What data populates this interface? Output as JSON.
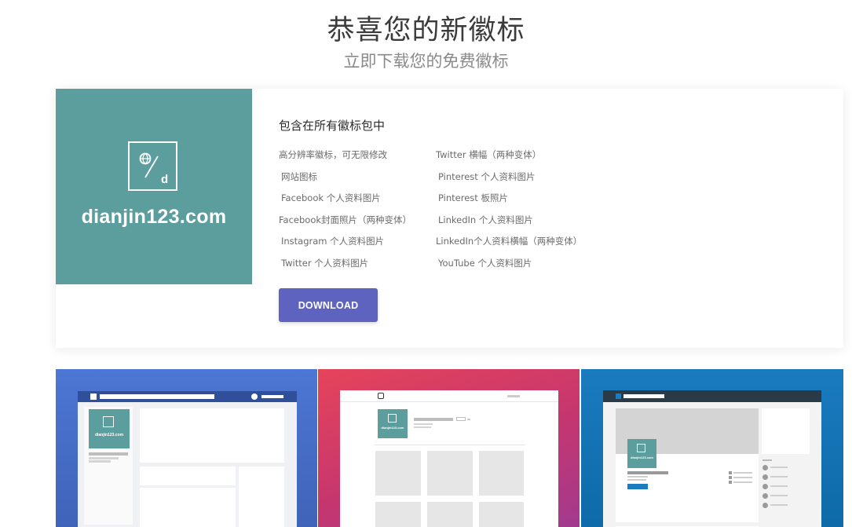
{
  "header": {
    "title": "恭喜您的新徽标",
    "subtitle": "立即下载您的免费徽标"
  },
  "logo": {
    "brand_text": "dianjin123.com",
    "mini_text": "dianjin123.com",
    "bg_color": "#5c9e9e"
  },
  "package": {
    "heading": "包含在所有徽标包中",
    "left_items": [
      "高分辨率徽标，可无限修改",
      "网站图标",
      "Facebook 个人资料图片",
      "Facebook封面照片（两种变体）",
      "Instagram 个人资料图片",
      "Twitter 个人资料图片"
    ],
    "right_items": [
      "Twitter 横幅（两种变体）",
      "Pinterest 个人资料图片",
      "Pinterest 板照片",
      "LinkedIn 个人资料图片",
      "LinkedIn个人资料横幅（两种变体）",
      "YouTube 个人资料图片"
    ],
    "download_label": "DOWNLOAD",
    "download_color": "#5e63c0"
  },
  "previews": {
    "facebook_color": "#4d77d4",
    "instagram_color": "#c5366f",
    "linkedin_color": "#1a7bbf"
  }
}
